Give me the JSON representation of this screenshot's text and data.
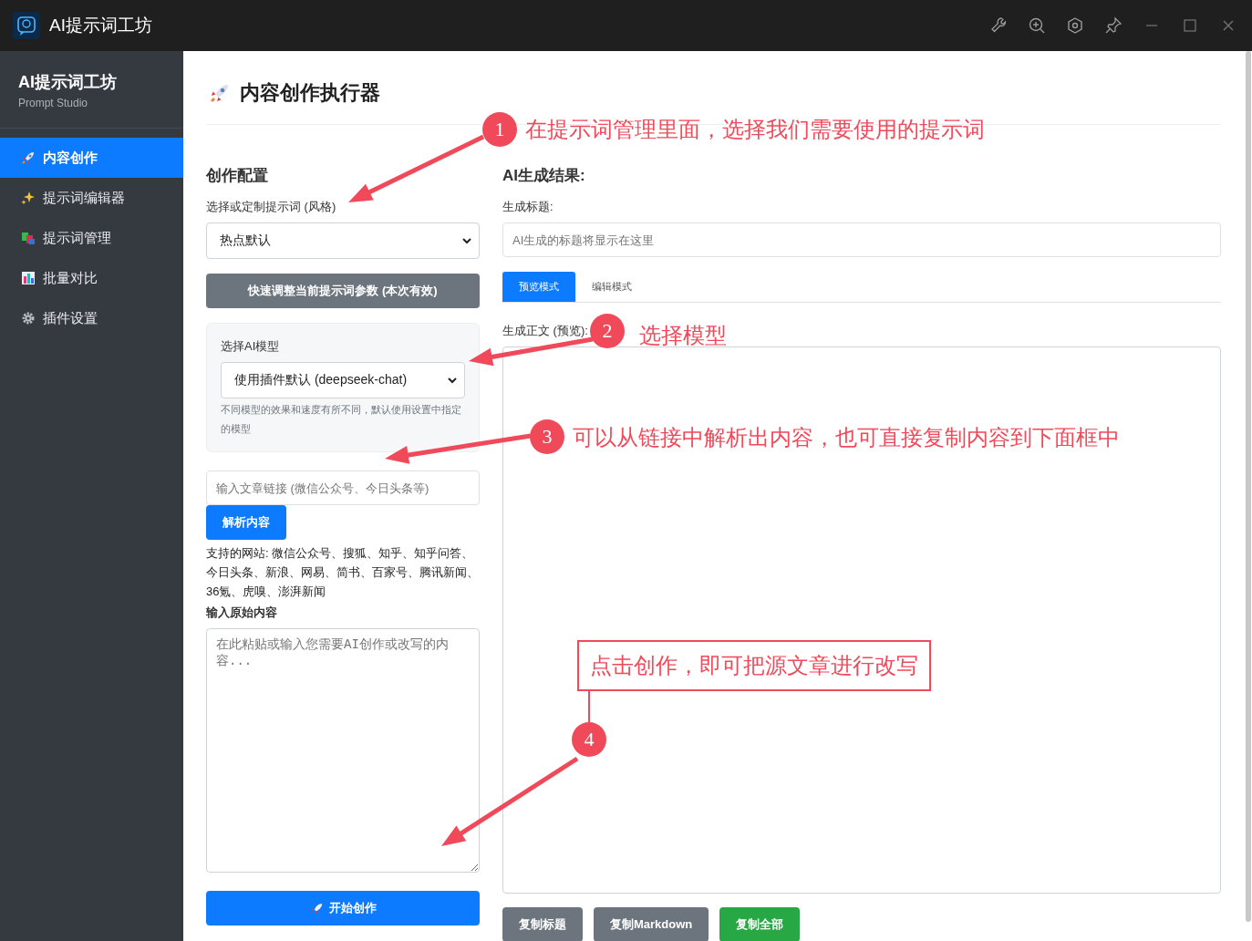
{
  "window": {
    "title": "AI提示词工坊"
  },
  "sidebar": {
    "brand": "AI提示词工坊",
    "subtitle": "Prompt Studio",
    "items": [
      {
        "label": "内容创作",
        "kind": "rocket",
        "selected": true
      },
      {
        "label": "提示词编辑器",
        "kind": "sparkle",
        "selected": false
      },
      {
        "label": "提示词管理",
        "kind": "blocks",
        "selected": false
      },
      {
        "label": "批量对比",
        "kind": "chart",
        "selected": false
      },
      {
        "label": "插件设置",
        "kind": "gear",
        "selected": false
      }
    ]
  },
  "page": {
    "title": "内容创作执行器"
  },
  "config": {
    "heading": "创作配置",
    "prompt_label": "选择或定制提示词 (风格)",
    "prompt_value": "热点默认",
    "adjust_button": "快速调整当前提示词参数 (本次有效)",
    "model_label": "选择AI模型",
    "model_value": "使用插件默认 (deepseek-chat)",
    "model_hint": "不同模型的效果和速度有所不同，默认使用设置中指定的模型",
    "link_placeholder": "输入文章链接 (微信公众号、今日头条等)",
    "parse_button": "解析内容",
    "supported": "支持的网站: 微信公众号、搜狐、知乎、知乎问答、今日头条、新浪、网易、简书、百家号、腾讯新闻、36氪、虎嗅、澎湃新闻",
    "source_label": "输入原始内容",
    "source_placeholder": "在此粘贴或输入您需要AI创作或改写的内容...",
    "start_button": "开始创作"
  },
  "result": {
    "heading": "AI生成结果:",
    "title_label": "生成标题:",
    "title_placeholder": "AI生成的标题将显示在这里",
    "tabs": [
      {
        "label": "预览模式",
        "selected": true
      },
      {
        "label": "编辑模式",
        "selected": false
      }
    ],
    "body_label": "生成正文 (预览):",
    "buttons": [
      {
        "label": "复制标题",
        "kind": "secondary"
      },
      {
        "label": "复制Markdown",
        "kind": "secondary"
      },
      {
        "label": "复制全部",
        "kind": "success"
      }
    ]
  },
  "annotations": [
    {
      "number": "1",
      "text": "在提示词管理里面，选择我们需要使用的提示词",
      "boxed": false
    },
    {
      "number": "2",
      "text": "选择模型",
      "boxed": false
    },
    {
      "number": "3",
      "text": "可以从链接中解析出内容，也可直接复制内容到下面框中",
      "boxed": false
    },
    {
      "number": "4",
      "text": "点击创作，即可把源文章进行改写",
      "boxed": true
    }
  ]
}
